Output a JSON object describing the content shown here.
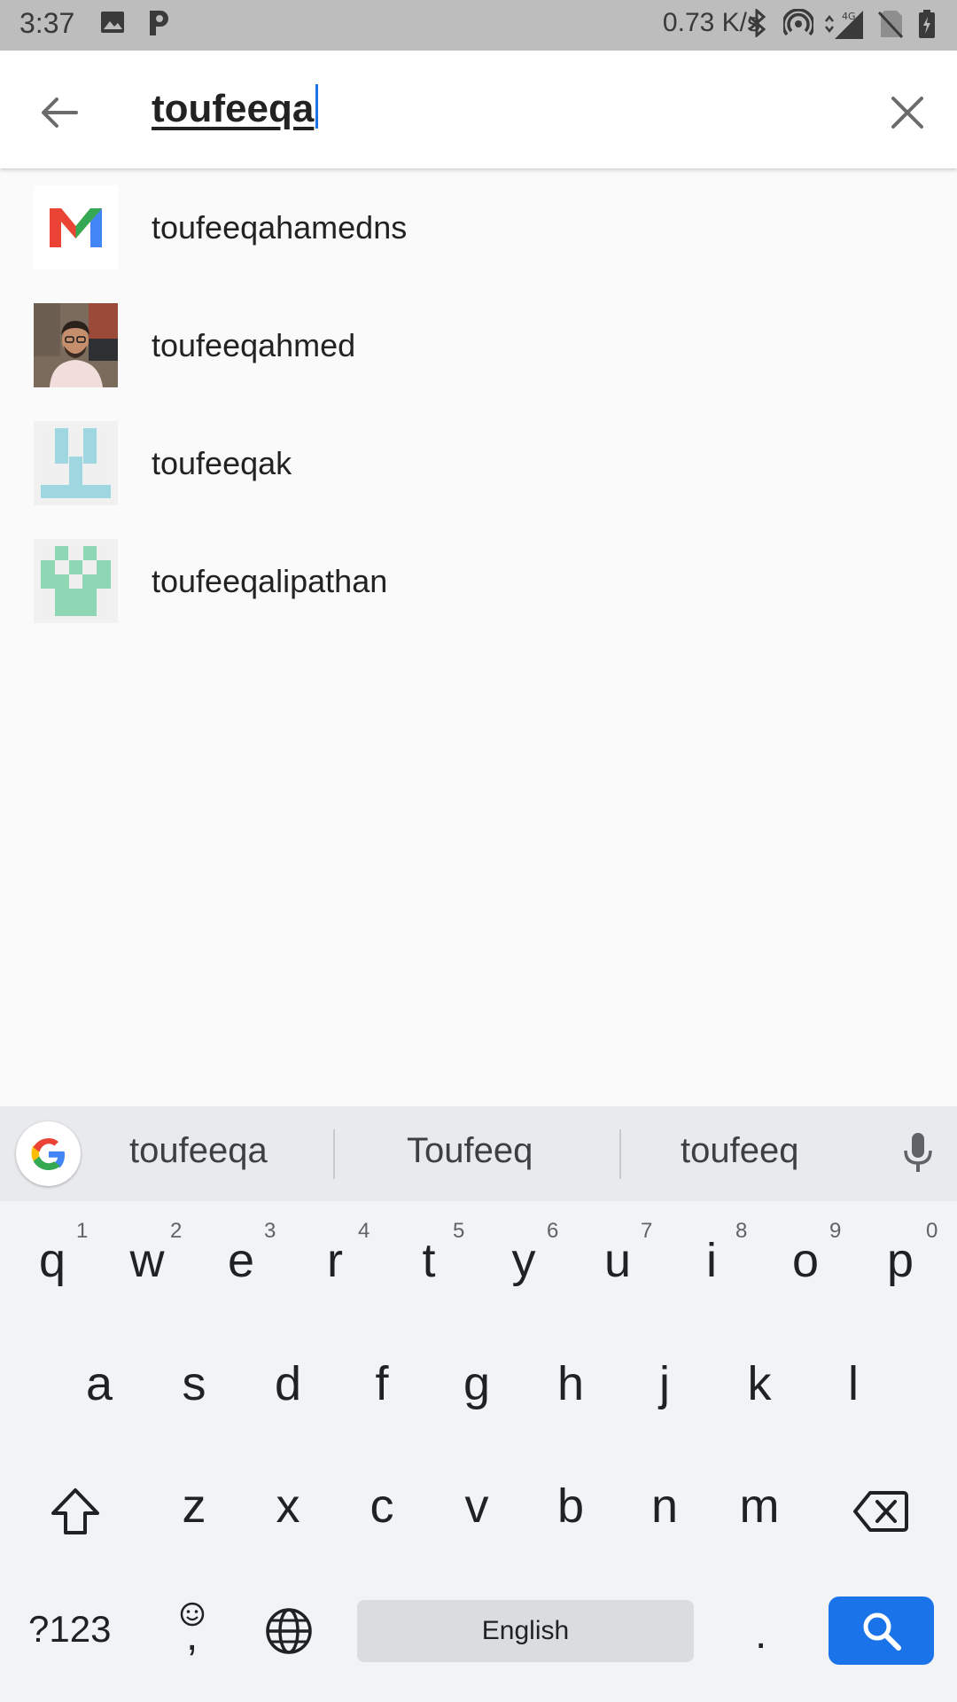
{
  "status_bar": {
    "time": "3:37",
    "speed": "0.73 K/s",
    "network": "4G"
  },
  "search": {
    "query": "toufeeqa"
  },
  "suggestions": [
    {
      "label": "toufeeqahamedns",
      "avatar": "gmail-logo-icon"
    },
    {
      "label": "toufeeqahmed",
      "avatar": "user-photo"
    },
    {
      "label": "toufeeqak",
      "avatar": "identicon-blue"
    },
    {
      "label": "toufeeqalipathan",
      "avatar": "identicon-green"
    }
  ],
  "keyboard": {
    "predictions": [
      "toufeeqa",
      "Toufeeq",
      "toufeeq"
    ],
    "row1": [
      "q",
      "w",
      "e",
      "r",
      "t",
      "y",
      "u",
      "i",
      "o",
      "p"
    ],
    "row1_hints": [
      "1",
      "2",
      "3",
      "4",
      "5",
      "6",
      "7",
      "8",
      "9",
      "0"
    ],
    "row2": [
      "a",
      "s",
      "d",
      "f",
      "g",
      "h",
      "j",
      "k",
      "l"
    ],
    "row3": [
      "z",
      "x",
      "c",
      "v",
      "b",
      "n",
      "m"
    ],
    "symbols_label": "?123",
    "comma_label": ",",
    "period_label": ".",
    "space_label": "English"
  },
  "colors": {
    "accent": "#1a73e8",
    "teal_identicon": "#9fd7e0",
    "green_identicon": "#8fd6b5"
  }
}
